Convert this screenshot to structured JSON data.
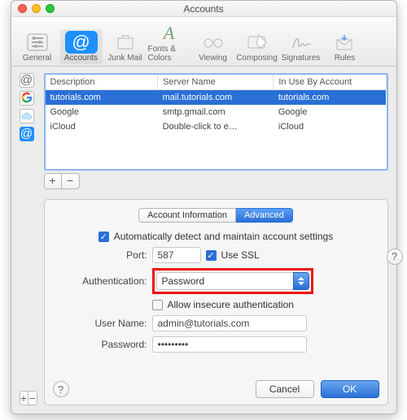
{
  "window": {
    "title": "Accounts"
  },
  "tools": [
    {
      "name": "general",
      "label": "General"
    },
    {
      "name": "accounts",
      "label": "Accounts"
    },
    {
      "name": "junk",
      "label": "Junk Mail"
    },
    {
      "name": "fonts",
      "label": "Fonts & Colors"
    },
    {
      "name": "viewing",
      "label": "Viewing"
    },
    {
      "name": "composing",
      "label": "Composing"
    },
    {
      "name": "signatures",
      "label": "Signatures"
    },
    {
      "name": "rules",
      "label": "Rules"
    }
  ],
  "table": {
    "headers": {
      "desc": "Description",
      "server": "Server Name",
      "inuse": "In Use By Account"
    },
    "rows": [
      {
        "desc": "tutorials.com",
        "server": "mail.tutorials.com",
        "inuse": "tutorials.com"
      },
      {
        "desc": "Google",
        "server": "smtp.gmail.com",
        "inuse": "Google"
      },
      {
        "desc": "iCloud",
        "server": "Double-click to e…",
        "inuse": "iCloud"
      }
    ]
  },
  "addremove": {
    "add": "+",
    "remove": "−"
  },
  "seg": {
    "info": "Account Information",
    "adv": "Advanced"
  },
  "auto": {
    "label": "Automatically detect and maintain account settings"
  },
  "port": {
    "label": "Port:",
    "value": "587"
  },
  "ssl": {
    "label": "Use SSL"
  },
  "auth": {
    "label": "Authentication:",
    "value": "Password"
  },
  "insecure": {
    "label": "Allow insecure authentication"
  },
  "user": {
    "label": "User Name:",
    "value": "admin@tutorials.com"
  },
  "pass": {
    "label": "Password:",
    "value": "•••••••••"
  },
  "buttons": {
    "help": "?",
    "cancel": "Cancel",
    "ok": "OK"
  },
  "left": {
    "plus": "+",
    "minus": "−"
  }
}
